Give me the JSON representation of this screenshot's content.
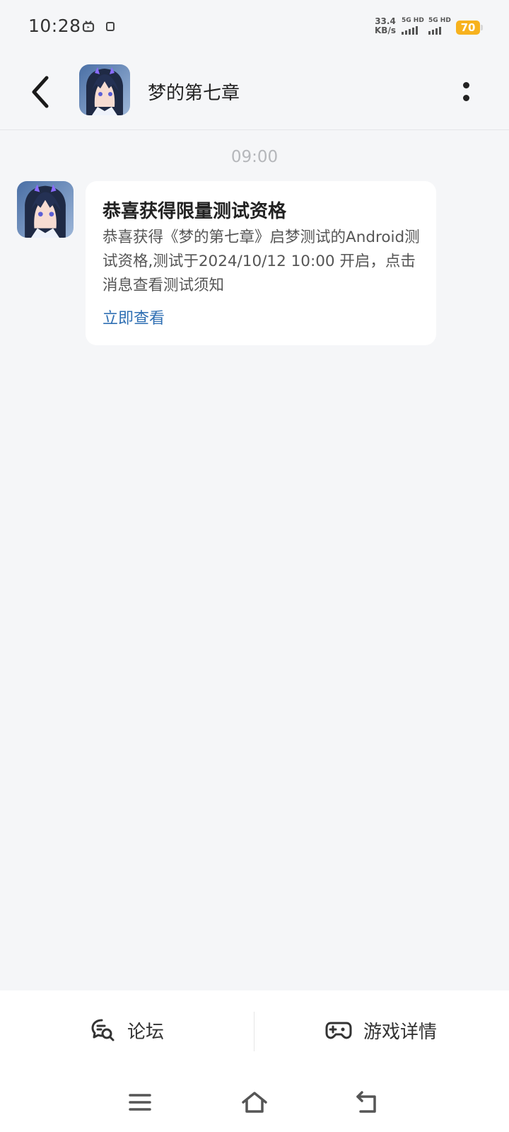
{
  "status_bar": {
    "time": "10:28",
    "net_speed_value": "33.4",
    "net_speed_unit": "KB/s",
    "sim1_label": "5G HD",
    "sim2_label": "5G HD",
    "battery": "70",
    "battery_color": "#f7b21e"
  },
  "header": {
    "title": "梦的第七章"
  },
  "chat": {
    "timestamp": "09:00",
    "message": {
      "title": "恭喜获得限量测试资格",
      "body": "恭喜获得《梦的第七章》启梦测试的Android测试资格,测试于2024/10/12 10:00 开启，点击消息查看测试须知",
      "link": "立即查看",
      "link_color": "#2f6fb3"
    }
  },
  "bottom_bar": {
    "forum_label": "论坛",
    "detail_label": "游戏详情"
  }
}
